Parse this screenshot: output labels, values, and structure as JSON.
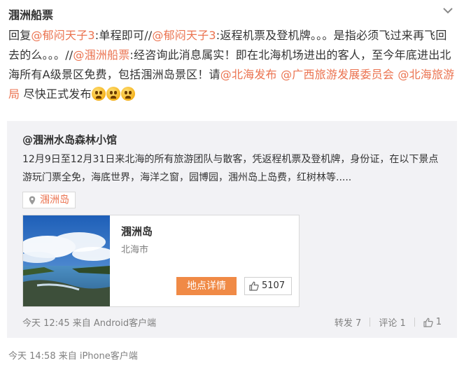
{
  "post": {
    "author": "涠洲船票",
    "text_segments": [
      {
        "text": "回复",
        "type": "text"
      },
      {
        "text": "@郁闷天子3",
        "type": "mention"
      },
      {
        "text": ":单程即可//",
        "type": "text"
      },
      {
        "text": "@郁闷天子3",
        "type": "mention"
      },
      {
        "text": ":返程机票及登机牌。。。是指必须飞过来再飞回去的么。。。//",
        "type": "text"
      },
      {
        "text": "@涠洲船票",
        "type": "mention"
      },
      {
        "text": ":经咨询此消息属实！即在北海机场进出的客人，至今年底进出北海所有A级景区免费，包括涠洲岛景区！请",
        "type": "text"
      },
      {
        "text": "@北海发布",
        "type": "mention"
      },
      {
        "text": " ",
        "type": "text"
      },
      {
        "text": "@广西旅游发展委员会",
        "type": "mention"
      },
      {
        "text": " ",
        "type": "text"
      },
      {
        "text": "@北海旅游局",
        "type": "mention"
      },
      {
        "text": " 尽快正式发布",
        "type": "text"
      }
    ],
    "emoji_count": 3,
    "meta": "今天 14:58 来自 iPhone客户端"
  },
  "repost": {
    "author": "@涠洲水岛森林小馆",
    "text": "12月9日至12月31日来北海的所有旅游团队与散客，凭返程机票及登机牌，身份证，在以下景点游玩门票全免，海底世界，海洋之窗，园博园，涠州岛上岛费，红树林等.....",
    "location": "涠洲岛",
    "card": {
      "title": "涠洲岛",
      "subtitle": "北海市",
      "detail_button": "地点详情",
      "likes": "5107"
    },
    "meta": "今天 12:45 来自 Android客户端",
    "actions": {
      "repost": "转发 7",
      "comment": "评论 1",
      "like": "1"
    }
  },
  "colors": {
    "accent": "#eb7350",
    "button": "#f08a46",
    "muted": "#808080",
    "repost_bg": "#f2f2f5"
  }
}
